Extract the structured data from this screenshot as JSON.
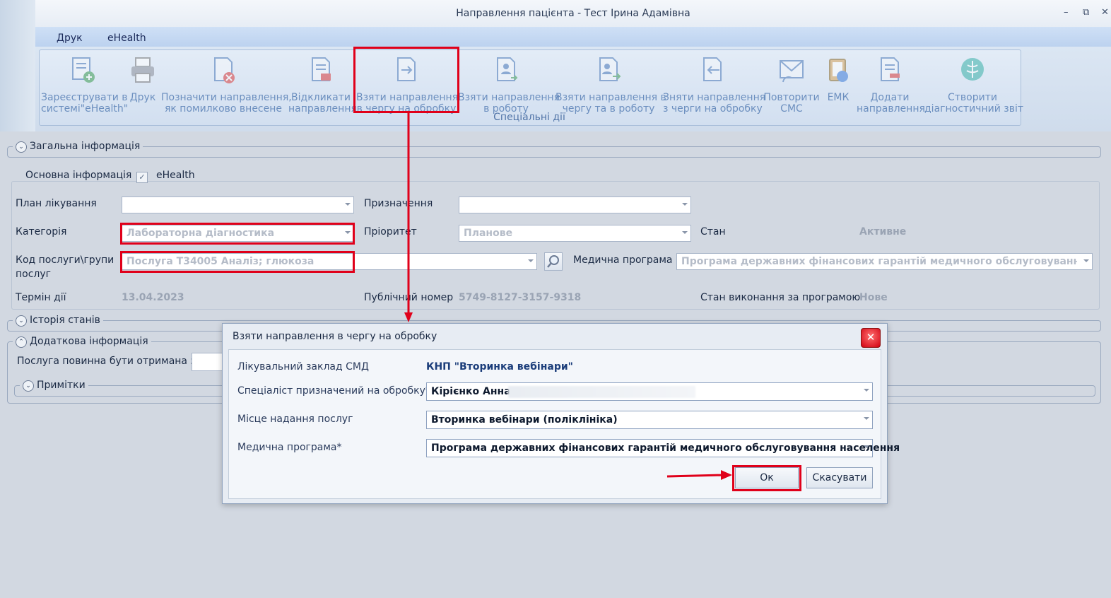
{
  "window": {
    "title": "Направлення пацієнта - Тест Ірина Адамівна",
    "minimize": "–",
    "restore": "⧉",
    "close": "✕"
  },
  "menu": {
    "items": [
      "Друк",
      "eHealth"
    ]
  },
  "ribbon": {
    "group_label": "Спеціальні дії",
    "buttons": [
      {
        "line1": "Зареєструвати в",
        "line2": "системі\"eHealth\"",
        "icon": "register-icon"
      },
      {
        "line1": "Друк",
        "line2": "",
        "icon": "printer-icon"
      },
      {
        "line1": "Позначити направлення,",
        "line2": "як помилково внесене",
        "icon": "doc-error-icon"
      },
      {
        "line1": "Відкликати",
        "line2": "направлення",
        "icon": "doc-revoke-icon"
      },
      {
        "line1": "Взяти направлення",
        "line2": "в чергу на обробку",
        "icon": "doc-arrow-icon"
      },
      {
        "line1": "Взяти направлення",
        "line2": "в роботу",
        "icon": "doc-user-icon"
      },
      {
        "line1": "Взяти направлення в",
        "line2": "чергу та в роботу",
        "icon": "doc-user-arrow-icon"
      },
      {
        "line1": "Зняти направлення",
        "line2": "з черги на обробку",
        "icon": "doc-back-icon"
      },
      {
        "line1": "Повторити",
        "line2": "СМС",
        "icon": "envelope-icon"
      },
      {
        "line1": "ЕМК",
        "line2": "",
        "icon": "emk-icon"
      },
      {
        "line1": "Додати",
        "line2": "направлення",
        "icon": "doc-add-icon"
      },
      {
        "line1": "Створити",
        "line2": "діагностичний звіт",
        "icon": "xray-icon"
      }
    ]
  },
  "general": {
    "title": "Загальна інформація",
    "basic_info_label": "Основна інформація",
    "ehealth_label": "eHealth",
    "ehealth_checked": true,
    "plan_label": "План лікування",
    "plan_value": "",
    "purpose_label": "Призначення",
    "purpose_value": "",
    "category_label": "Категорія",
    "category_value": "Лабораторна діагностика",
    "priority_label": "Пріоритет",
    "priority_value": "Планове",
    "state_label": "Стан",
    "state_value": "Активне",
    "service_code_label_1": "Код послуги\\групи",
    "service_code_label_2": "послуг",
    "service_code_value": "Послуга Т34005 Аналіз; глюкоза",
    "med_program_label": "Медична програма",
    "med_program_value": "Програма державних фінансових гарантій медичного обслуговування насел",
    "term_label": "Термін дії",
    "term_value": "13.04.2023",
    "public_number_label": "Публічний номер",
    "public_number_value": "5749-8127-3157-9318",
    "program_state_label": "Стан виконання за програмою",
    "program_state_value": "Нове"
  },
  "history": {
    "title": "Історія станів"
  },
  "extra": {
    "title": "Додаткова інформація",
    "service_from_label": "Послуга повинна бути отримана з"
  },
  "notes": {
    "title": "Примітки"
  },
  "dialog": {
    "title": "Взяти направлення в чергу на обробку",
    "facility_label": "Лікувальний заклад СМД",
    "facility_value": "КНП \"Вторинка вебінари\"",
    "specialist_label": "Спеціаліст призначений на обробку*",
    "specialist_value": "Кірієнко Анна",
    "place_label": "Місце надання послуг",
    "place_value": "Вторинка вебінари (поліклініка)",
    "program_label": "Медична програма*",
    "program_value": "Програма державних фінансових гарантій медичного обслуговування населення",
    "ok_label": "Ок",
    "cancel_label": "Скасувати"
  },
  "colors": {
    "highlight": "#e0001a",
    "accent": "#1b3d7a"
  }
}
